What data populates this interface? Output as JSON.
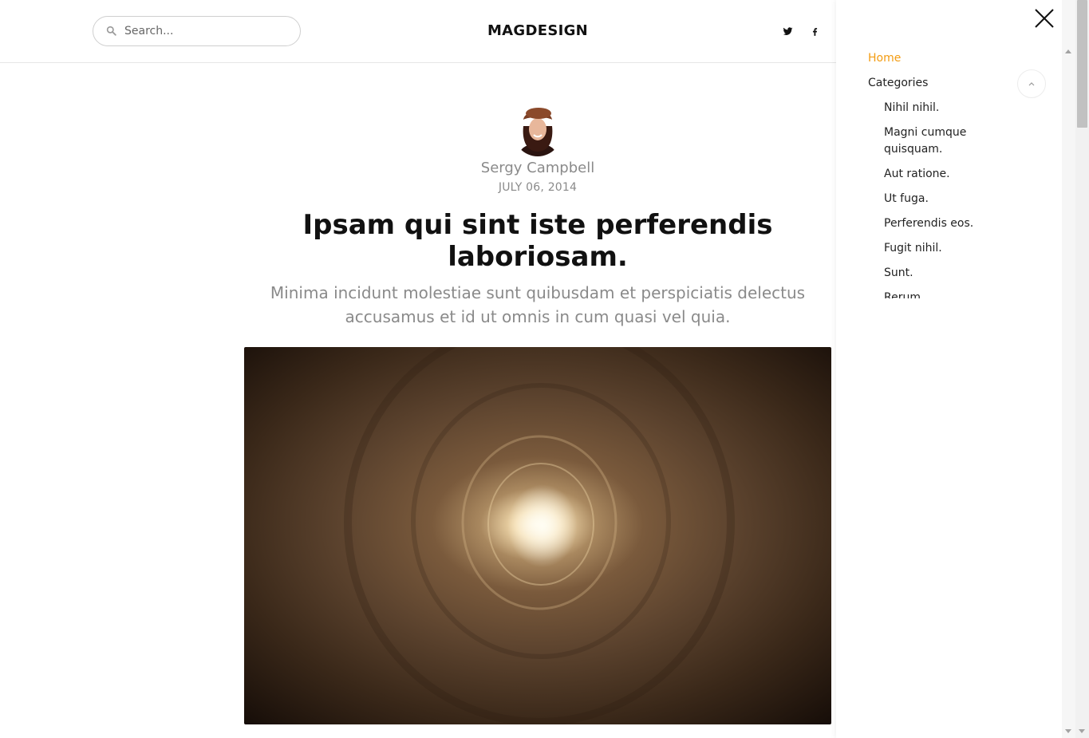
{
  "header": {
    "search_placeholder": "Search...",
    "brand": "MAGDESIGN",
    "social": [
      "twitter-icon",
      "facebook-icon"
    ]
  },
  "article": {
    "author": "Sergy Campbell",
    "date": "JULY 06, 2014",
    "title": "Ipsam qui sint iste perferendis laboriosam.",
    "subtitle": "Minima incidunt molestiae sunt quibusdam et perspiciatis delectus accusamus et id ut omnis in cum quasi vel quia."
  },
  "menu": {
    "home": "Home",
    "categories": "Categories",
    "subcategories": [
      "Nihil nihil.",
      "Magni cumque quisquam.",
      "Aut ratione.",
      "Ut fuga.",
      "Perferendis eos.",
      "Fugit nihil.",
      "Sunt.",
      "Rerum"
    ]
  },
  "colors": {
    "accent": "#f39c12",
    "muted": "#8a8a8a",
    "text": "#111111"
  }
}
